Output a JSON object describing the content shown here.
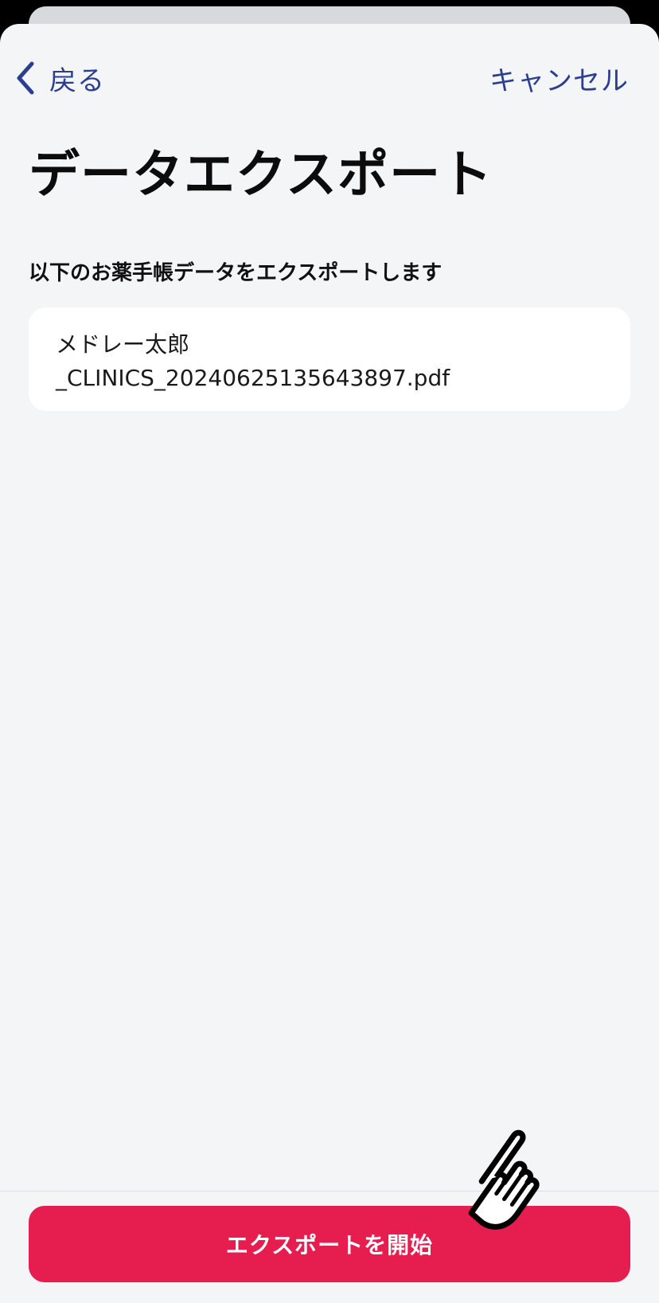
{
  "nav": {
    "back_label": "戻る",
    "cancel_label": "キャンセル"
  },
  "title": "データエクスポート",
  "section": {
    "label": "以下のお薬手帳データをエクスポートします"
  },
  "file": {
    "name_line1": "メドレー太郎",
    "name_line2": "_CLINICS_20240625135643897.pdf"
  },
  "action": {
    "primary_label": "エクスポートを開始"
  },
  "colors": {
    "accent": "#2c3f8f",
    "primary_button": "#e61e50",
    "background": "#f3f5f7"
  },
  "icons": {
    "back": "chevron-left-icon",
    "pointer": "hand-pointer-icon"
  }
}
